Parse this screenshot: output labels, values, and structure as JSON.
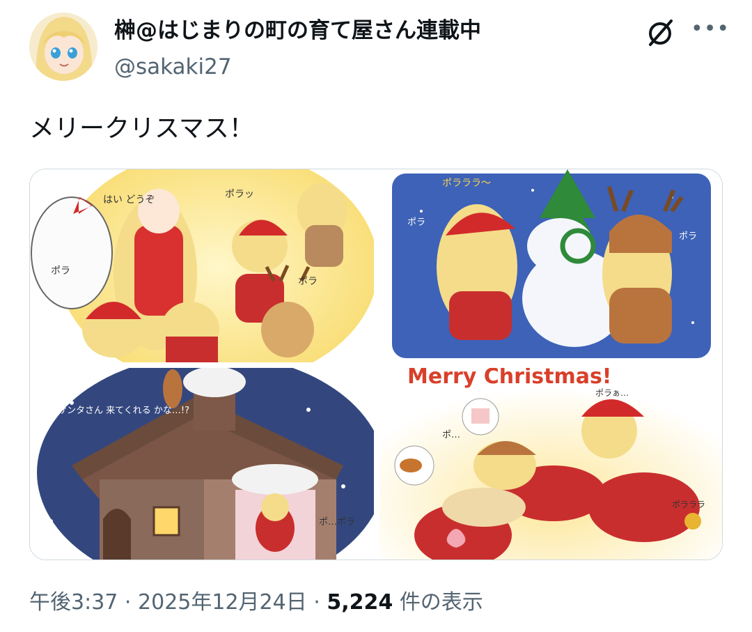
{
  "author": {
    "display_name": "榊@はじまりの町の育て屋さん連載中",
    "handle": "@sakaki27"
  },
  "tweet": {
    "text": "メリークリスマス！"
  },
  "media": {
    "panels": [
      {
        "bubbles": [
          "はい どうぞ",
          "ポラッ",
          "ポラ",
          "ポラ"
        ]
      },
      {
        "bubbles": [
          "ポラララ〜",
          "ポラ",
          "ポラ"
        ]
      },
      {
        "bubbles": [
          "サンタさん 来てくれる かな…!?",
          "ポ…ポラ"
        ]
      },
      {
        "bubbles": [
          "Merry Christmas!",
          "ポラぁ…",
          "ポ…",
          "ポラララ"
        ]
      }
    ]
  },
  "meta": {
    "time": "午後3:37",
    "separator": "·",
    "date": "2025年12月24日",
    "views_count": "5,224",
    "views_label": "件の表示"
  },
  "icons": {
    "grok": "grok-icon",
    "more": "more-icon"
  },
  "colors": {
    "text_primary": "#0f1419",
    "text_secondary": "#536471",
    "border": "#cfd9de"
  }
}
